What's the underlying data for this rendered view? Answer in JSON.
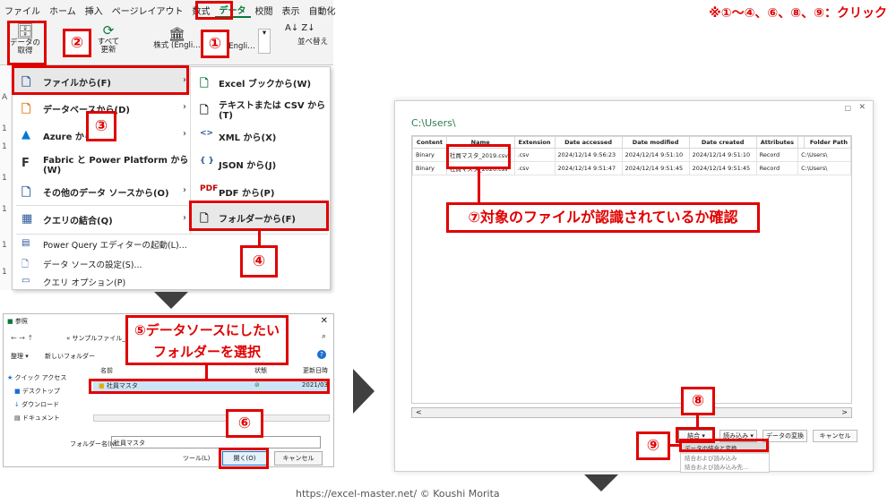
{
  "instruction": "※①～④、⑥、⑧、⑨：クリック",
  "ribbon": {
    "tabs": [
      "ファイル",
      "ホーム",
      "挿入",
      "ページレイアウト",
      "数式",
      "データ",
      "校閲",
      "表示",
      "自動化"
    ],
    "active_tab": "データ",
    "get_data_label_1": "データの",
    "get_data_label_2": "取得",
    "refresh_label_1": "すべて",
    "refresh_label_2": "更新",
    "stocks_label": "株式 (Engli…",
    "geo_label": "Engli…",
    "sort_label": "並べ替え"
  },
  "badges": [
    "①",
    "②",
    "③",
    "④",
    "⑥",
    "⑧",
    "⑨"
  ],
  "menu": {
    "items": [
      {
        "label": "ファイルから(F)",
        "icon": "file-icon"
      },
      {
        "label": "データベースから(D)",
        "icon": "database-icon"
      },
      {
        "label": "Azure から",
        "icon": "azure-icon"
      },
      {
        "label": "Fabric と Power Platform から(W)",
        "icon": "fabric-icon"
      },
      {
        "label": "その他のデータ ソースから(O)",
        "icon": "other-source-icon"
      },
      {
        "label": "クエリの結合(Q)",
        "icon": "combine-query-icon"
      }
    ],
    "small_items": [
      "Power Query エディターの起動(L)...",
      "データ ソースの設定(S)...",
      "クエリ オプション(P)"
    ],
    "submenu": [
      "Excel ブックから(W)",
      "テキストまたは CSV から(T)",
      "XML から(X)",
      "JSON から(J)",
      "PDF から(P)",
      "フォルダーから(F)"
    ]
  },
  "dialog": {
    "title": "参照",
    "breadcrumb": "« サンプルファイル_F",
    "organize": "整理 ▾",
    "new_folder": "新しいフォルダー",
    "nav_items": [
      "クイック アクセス",
      "デスクトップ",
      "ダウンロード",
      "ドキュメント"
    ],
    "col_name": "名前",
    "col_status": "状態",
    "col_modified": "更新日時",
    "folder_row": "社員マスタ",
    "folder_date": "2021/03",
    "folder_name_label": "フォルダー名(N):",
    "folder_name_value": "社員マスタ",
    "tools": "ツール(L)",
    "open": "開く(O)",
    "cancel": "キャンセル"
  },
  "callout5_line1": "⑤データソースにしたい",
  "callout5_line2": "フォルダーを選択",
  "callout7": "⑦対象のファイルが認識されているか確認",
  "window": {
    "path": "C:\\Users\\",
    "columns": [
      "Content",
      "Name",
      "Extension",
      "Date accessed",
      "Date modified",
      "Date created",
      "Attributes",
      "",
      "Folder Path"
    ],
    "rows": [
      [
        "Binary",
        "社員マスタ_2019.csv",
        ".csv",
        "2024/12/14 9:56:23",
        "2024/12/14 9:51:10",
        "2024/12/14 9:51:10",
        "Record",
        "C:\\Users\\"
      ],
      [
        "Binary",
        "社員マスタ_2020.csv",
        ".csv",
        "2024/12/14 9:51:47",
        "2024/12/14 9:51:45",
        "2024/12/14 9:51:45",
        "Record",
        "C:\\Users\\"
      ]
    ],
    "buttons": [
      "結合 ▾",
      "読み込み ▾",
      "データの変換",
      "キャンセル"
    ],
    "dropdown": [
      "データの結合と変換",
      "結合および読み込み",
      "結合および読み込み先..."
    ]
  },
  "footer": "https://excel-master.net/ © Koushi Morita"
}
